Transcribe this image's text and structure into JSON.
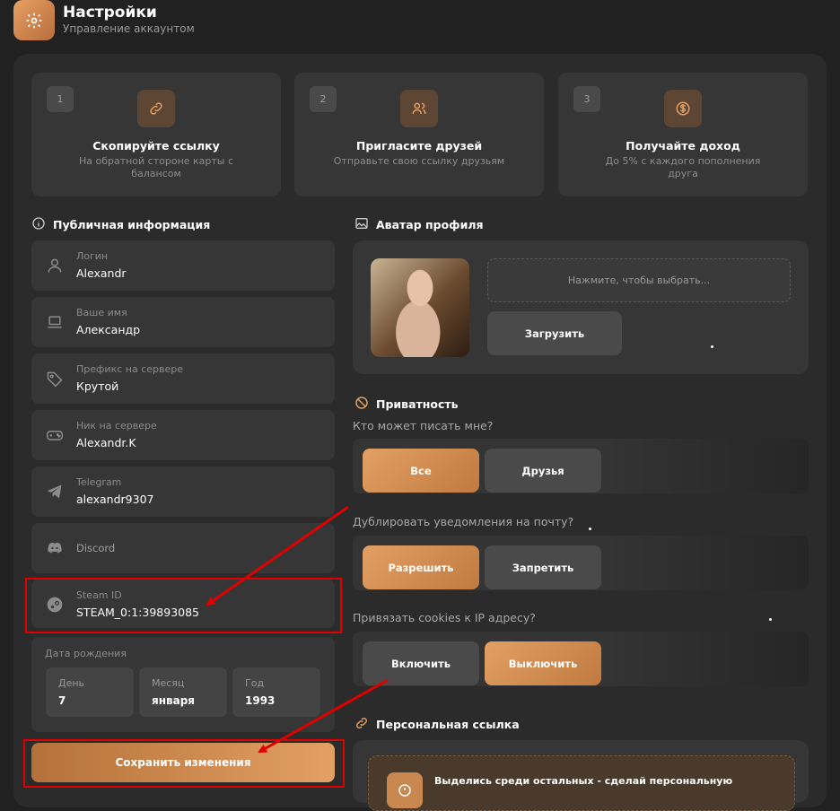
{
  "header": {
    "title": "Настройки",
    "subtitle": "Управление аккаунтом"
  },
  "steps": [
    {
      "num": "1",
      "title": "Скопируйте ссылку",
      "desc": "На обратной стороне карты с балансом",
      "icon": "link-icon"
    },
    {
      "num": "2",
      "title": "Пригласите друзей",
      "desc": "Отправьте свою ссылку друзьям",
      "icon": "users-icon"
    },
    {
      "num": "3",
      "title": "Получайте доход",
      "desc": "До 5% с каждого пополнения друга",
      "icon": "dollar-coin-icon"
    }
  ],
  "public": {
    "title": "Публичная информация",
    "fields": [
      {
        "label": "Логин",
        "value": "Alexandr",
        "icon": "user-icon"
      },
      {
        "label": "Ваше имя",
        "value": "Александр",
        "icon": "laptop-icon"
      },
      {
        "label": "Префикс на сервере",
        "value": "Крутой",
        "icon": "tag-icon"
      },
      {
        "label": "Ник на сервере",
        "value": "Alexandr.K",
        "icon": "gamepad-icon"
      },
      {
        "label": "Telegram",
        "value": "alexandr9307",
        "icon": "telegram-icon"
      },
      {
        "label": "Discord",
        "value": "",
        "icon": "discord-icon"
      },
      {
        "label": "Steam ID",
        "value": "STEAM_0:1:39893085",
        "icon": "steam-icon"
      }
    ],
    "birth": {
      "title": "Дата рождения",
      "day_label": "День",
      "day": "7",
      "month_label": "Месяц",
      "month": "января",
      "year_label": "Год",
      "year": "1993"
    },
    "save_label": "Сохранить изменения"
  },
  "avatar": {
    "title": "Аватар профиля",
    "drop_text": "Нажмите, чтобы выбрать...",
    "upload_label": "Загрузить"
  },
  "privacy": {
    "title": "Приватность",
    "q1": "Кто может писать мне?",
    "q1_opts": [
      "Все",
      "Друзья"
    ],
    "q2": "Дублировать уведомления на почту?",
    "q2_opts": [
      "Разрешить",
      "Запретить"
    ],
    "q3": "Привязать cookies к IP адресу?",
    "q3_opts": [
      "Включить",
      "Выключить"
    ]
  },
  "personal_link": {
    "title": "Персональная ссылка",
    "text": "Выделись среди остальных - сделай персональную"
  },
  "colors": {
    "accent": "#e3a064",
    "annotation": "#e00000"
  }
}
